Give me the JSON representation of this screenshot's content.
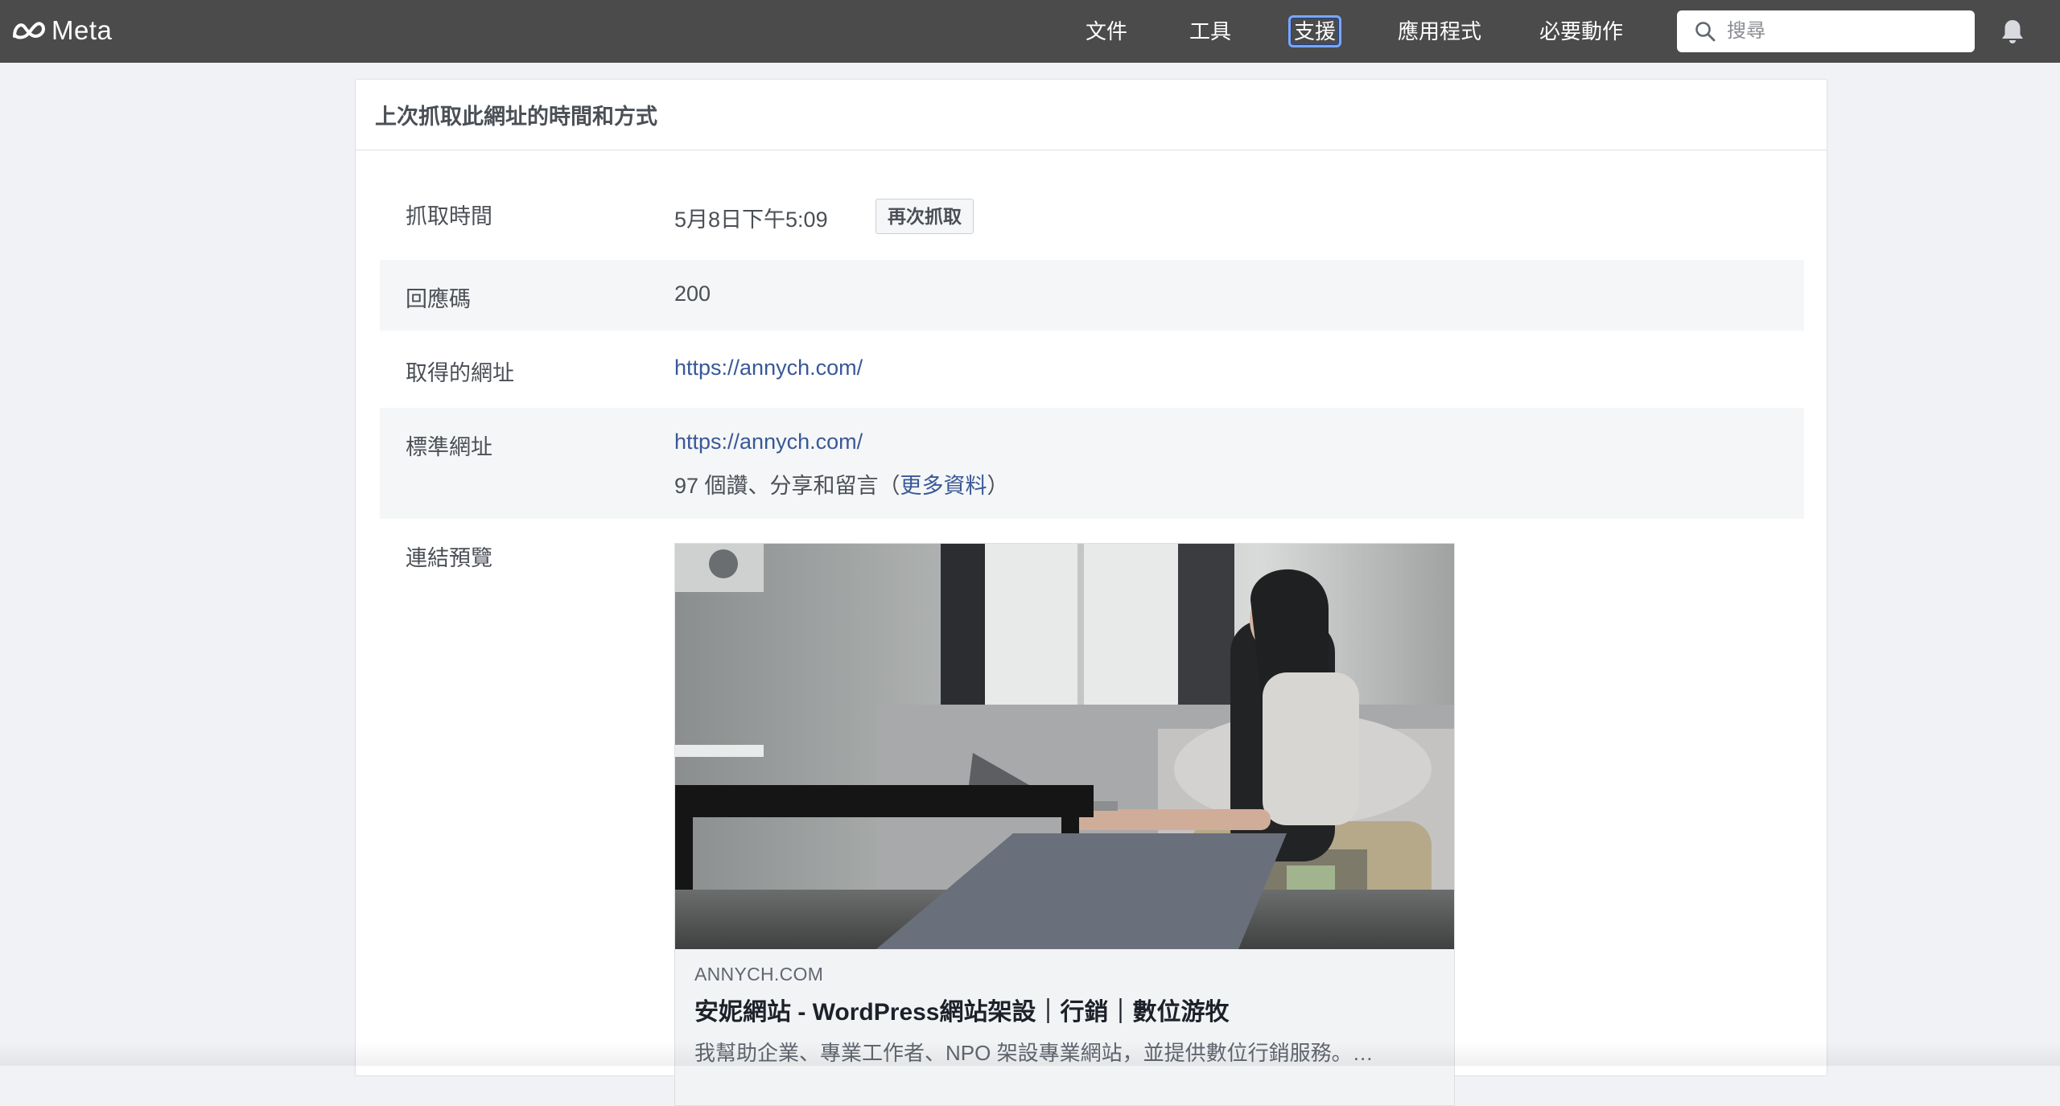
{
  "topbar": {
    "brand": "Meta",
    "nav": [
      {
        "label": "文件",
        "active": false
      },
      {
        "label": "工具",
        "active": false
      },
      {
        "label": "支援",
        "active": true
      },
      {
        "label": "應用程式",
        "active": false
      },
      {
        "label": "必要動作",
        "active": false
      }
    ],
    "search_placeholder": "搜尋"
  },
  "card": {
    "title": "上次抓取此網址的時間和方式",
    "rows": {
      "fetch_time": {
        "label": "抓取時間",
        "value": "5月8日下午5:09",
        "button": "再次抓取"
      },
      "response_code": {
        "label": "回應碼",
        "value": "200"
      },
      "fetched_url": {
        "label": "取得的網址",
        "value": "https://annych.com/"
      },
      "canonical_url": {
        "label": "標準網址",
        "value": "https://annych.com/",
        "engagement_prefix": "97 個讚、分享和留言（",
        "engagement_link": "更多資料",
        "engagement_suffix": "）"
      },
      "link_preview": {
        "label": "連結預覽"
      }
    },
    "preview": {
      "domain": "ANNYCH.COM",
      "title": "安妮網站 - WordPress網站架設｜行銷｜數位游牧",
      "description": "我幫助企業、專業工作者、NPO 架設專業網站，並提供數位行銷服務。…"
    }
  },
  "colors": {
    "topbar": "#4b4b4b",
    "page_bg": "#f0f2f5",
    "link": "#385898",
    "active_outline": "#7aa6ff"
  },
  "icons": [
    "meta-logo-icon",
    "search-icon",
    "bell-icon"
  ]
}
